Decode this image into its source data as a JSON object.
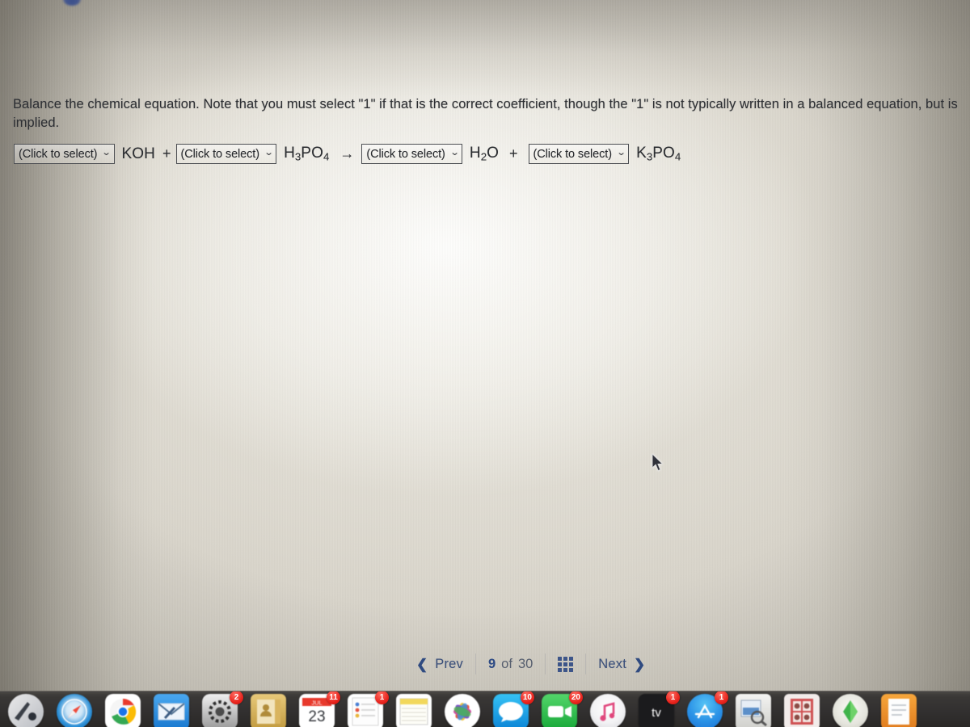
{
  "question": {
    "prompt": "Balance the chemical equation.  Note that you must select \"1\" if that is the correct coefficient, though the \"1\" is not typically written in a balanced equation, but is implied.",
    "select_placeholder": "(Click to select)",
    "chevron": "⌄",
    "equation": {
      "reactants": [
        {
          "coefficient_placeholder": "(Click to select)",
          "formula": "KOH",
          "formula_parts": [
            {
              "t": "KOH"
            }
          ]
        },
        {
          "coefficient_placeholder": "(Click to select)",
          "formula": "H3PO4",
          "formula_parts": [
            {
              "t": "H"
            },
            {
              "t": "3",
              "sub": true
            },
            {
              "t": "PO"
            },
            {
              "t": "4",
              "sub": true
            }
          ]
        }
      ],
      "arrow": "→",
      "plus": "+",
      "products": [
        {
          "coefficient_placeholder": "(Click to select)",
          "formula": "H2O",
          "formula_parts": [
            {
              "t": "H"
            },
            {
              "t": "2",
              "sub": true
            },
            {
              "t": "O"
            }
          ]
        },
        {
          "coefficient_placeholder": "(Click to select)",
          "formula": "K3PO4",
          "formula_parts": [
            {
              "t": "K"
            },
            {
              "t": "3",
              "sub": true
            },
            {
              "t": "PO"
            },
            {
              "t": "4",
              "sub": true
            }
          ]
        }
      ]
    }
  },
  "pager": {
    "prev_label": "Prev",
    "prev_arrow": "❮",
    "next_label": "Next",
    "next_arrow": "❯",
    "current_page": "9",
    "of_label": "of",
    "total_pages": "30",
    "grid_icon_name": "grid-view-icon",
    "accent_color": "#2d4a84"
  },
  "dock": {
    "items": [
      {
        "name": "finder",
        "badge": ""
      },
      {
        "name": "safari",
        "badge": ""
      },
      {
        "name": "chrome",
        "badge": ""
      },
      {
        "name": "mail",
        "badge": ""
      },
      {
        "name": "system-preferences",
        "badge": "2"
      },
      {
        "name": "contacts",
        "badge": ""
      },
      {
        "name": "calendar",
        "badge": "11",
        "month": "JUL",
        "day": "23"
      },
      {
        "name": "reminders",
        "badge": "1"
      },
      {
        "name": "notes",
        "badge": ""
      },
      {
        "name": "photos",
        "badge": ""
      },
      {
        "name": "messages",
        "badge": "10"
      },
      {
        "name": "facetime",
        "badge": "20"
      },
      {
        "name": "itunes",
        "badge": ""
      },
      {
        "name": "apple-tv",
        "badge": "1",
        "label": "tv"
      },
      {
        "name": "app-store",
        "badge": "1"
      },
      {
        "name": "preview",
        "badge": ""
      },
      {
        "name": "photo-booth",
        "badge": ""
      },
      {
        "name": "sims",
        "badge": ""
      },
      {
        "name": "pages",
        "badge": ""
      }
    ]
  }
}
